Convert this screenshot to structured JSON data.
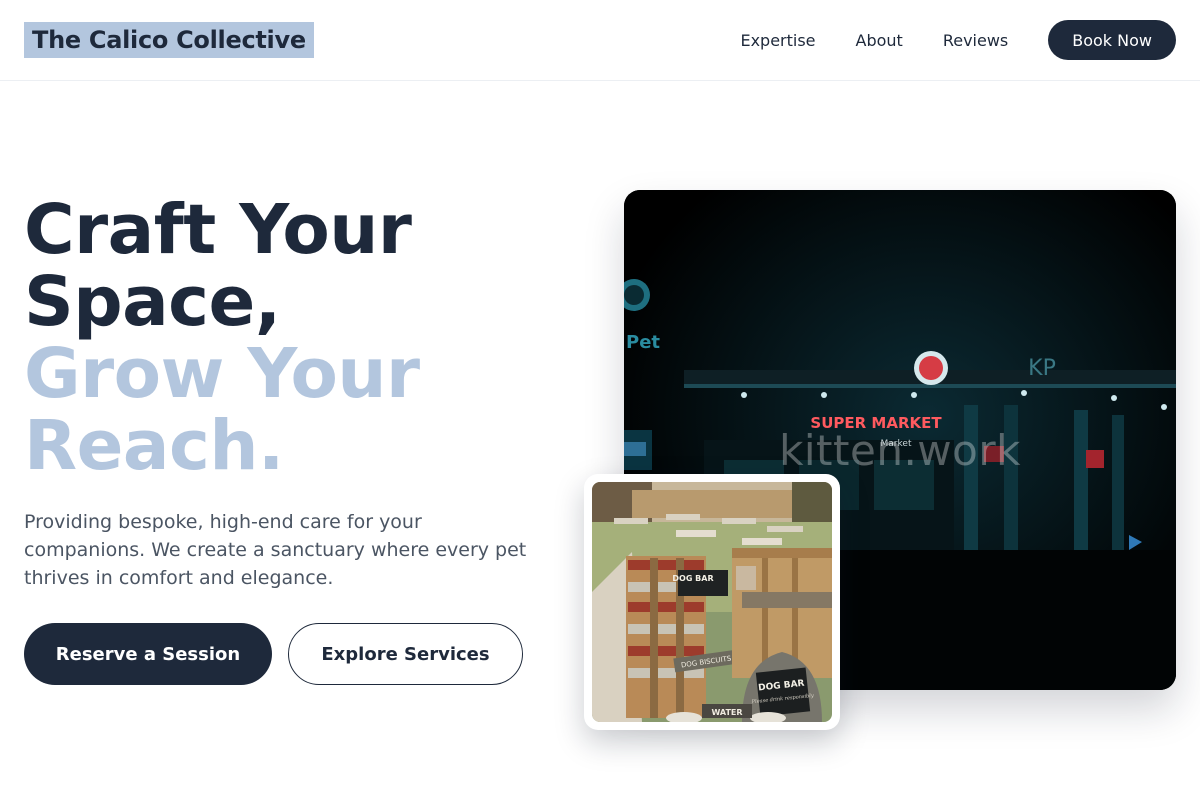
{
  "header": {
    "brand": "The Calico Collective",
    "nav": [
      "Expertise",
      "About",
      "Reviews"
    ],
    "cta_label": "Book Now"
  },
  "hero": {
    "title_line1": "Craft Your",
    "title_line2": "Space,",
    "title_line3": "Grow Your",
    "title_line4": "Reach.",
    "subtitle": "Providing bespoke, high-end care for your companions. We create a sanctuary where every pet thrives in comfort and elegance.",
    "primary_button": "Reserve a Session",
    "secondary_button": "Explore Services"
  },
  "images": {
    "main_watermark": "kitten.work",
    "main_signage": "SUPER MARKET",
    "main_signage_small": "Market",
    "main_sign_right": "KP",
    "main_sign_left": "Pet",
    "inset_sign_1": "DOG BAR",
    "inset_sign_2": "DOG BAR",
    "inset_sign_2_sub": "Please drink responsibly",
    "inset_sign_3": "DOG BISCUITS",
    "inset_sign_4": "WATER"
  },
  "colors": {
    "navy": "#1e293b",
    "accent": "#b3c6de",
    "body_text": "#4b5563"
  }
}
